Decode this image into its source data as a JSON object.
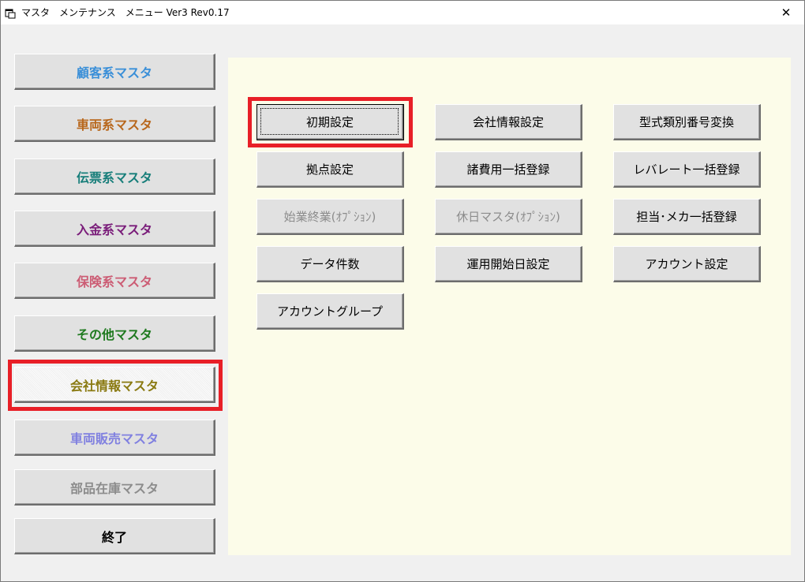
{
  "window": {
    "title": "マスタ　メンテナンス　メニュー Ver3 Rev0.17",
    "close_glyph": "✕"
  },
  "colors": {
    "highlight_border": "#e81f27",
    "panel_background": "#fcfce9",
    "disabled_text": "#8c8c8c"
  },
  "sidebar": {
    "items": [
      {
        "label": "顧客系マスタ",
        "color": "#3a8fd8",
        "state": "enabled"
      },
      {
        "label": "車両系マスタ",
        "color": "#b8671c",
        "state": "enabled"
      },
      {
        "label": "伝票系マスタ",
        "color": "#177e7a",
        "state": "enabled"
      },
      {
        "label": "入金系マスタ",
        "color": "#7a1d7a",
        "state": "enabled"
      },
      {
        "label": "保険系マスタ",
        "color": "#cc5c74",
        "state": "enabled"
      },
      {
        "label": "その他マスタ",
        "color": "#1f7a1f",
        "state": "enabled"
      },
      {
        "label": "会社情報マスタ",
        "color": "#8a7a12",
        "state": "selected"
      },
      {
        "label": "車両販売マスタ",
        "color": "#8080e0",
        "state": "enabled"
      },
      {
        "label": "部品在庫マスタ",
        "color": "#8c8c8c",
        "state": "disabled"
      },
      {
        "label": "終了",
        "color": "#000000",
        "state": "enabled"
      }
    ]
  },
  "main": {
    "buttons": [
      {
        "label": "初期設定",
        "state": "focused"
      },
      {
        "label": "会社情報設定",
        "state": "enabled"
      },
      {
        "label": "型式類別番号変換",
        "state": "enabled"
      },
      {
        "label": "拠点設定",
        "state": "enabled"
      },
      {
        "label": "諸費用一括登録",
        "state": "enabled"
      },
      {
        "label": "レバレート一括登録",
        "state": "enabled"
      },
      {
        "label": "始業終業(ｵﾌﾟｼｮﾝ)",
        "state": "disabled"
      },
      {
        "label": "休日マスタ(ｵﾌﾟｼｮﾝ)",
        "state": "disabled"
      },
      {
        "label": "担当･メカ一括登録",
        "state": "enabled"
      },
      {
        "label": "データ件数",
        "state": "enabled"
      },
      {
        "label": "運用開始日設定",
        "state": "enabled"
      },
      {
        "label": "アカウント設定",
        "state": "enabled"
      },
      {
        "label": "アカウントグループ",
        "state": "enabled"
      }
    ]
  }
}
